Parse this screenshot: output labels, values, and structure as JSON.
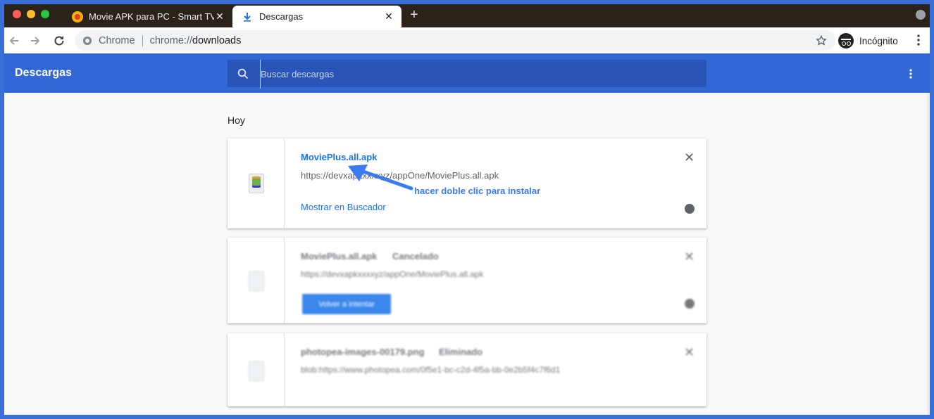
{
  "browser": {
    "tabs": [
      {
        "title": "Movie APK para PC - Smart TV",
        "active": false
      },
      {
        "title": "Descargas",
        "active": true
      }
    ],
    "new_tab_label": "+",
    "omnibox": {
      "site_label": "Chrome",
      "url_prefix": "chrome://",
      "url_path": "downloads"
    },
    "incognito_label": "Incógnito"
  },
  "page": {
    "title": "Descargas",
    "search_placeholder": "Buscar descargas",
    "section_label": "Hoy"
  },
  "downloads": [
    {
      "file_name": "MoviePlus.all.apk",
      "url": "https://devxapkxxxxyz/appOne/MoviePlus.all.apk",
      "action_link": "Mostrar en Buscador"
    },
    {
      "file_name": "MoviePlus.all.apk",
      "status": "Cancelado",
      "url": "https://devxapkxxxxyz/appOne/MoviePlus.all.apk",
      "action_button": "Volver a intentar"
    },
    {
      "file_name": "photopea-images-00179.png",
      "status": "Eliminado",
      "url": "blob:https://www.photopea.com/0f5e1-bc-c2d-4f5a-bb-0e2b5f4c7f6d1"
    }
  ],
  "annotation": {
    "text": "hacer doble clic para instalar"
  },
  "colors": {
    "accent": "#3367d6",
    "link": "#1a73e8",
    "frame": "#3a6fd8"
  }
}
